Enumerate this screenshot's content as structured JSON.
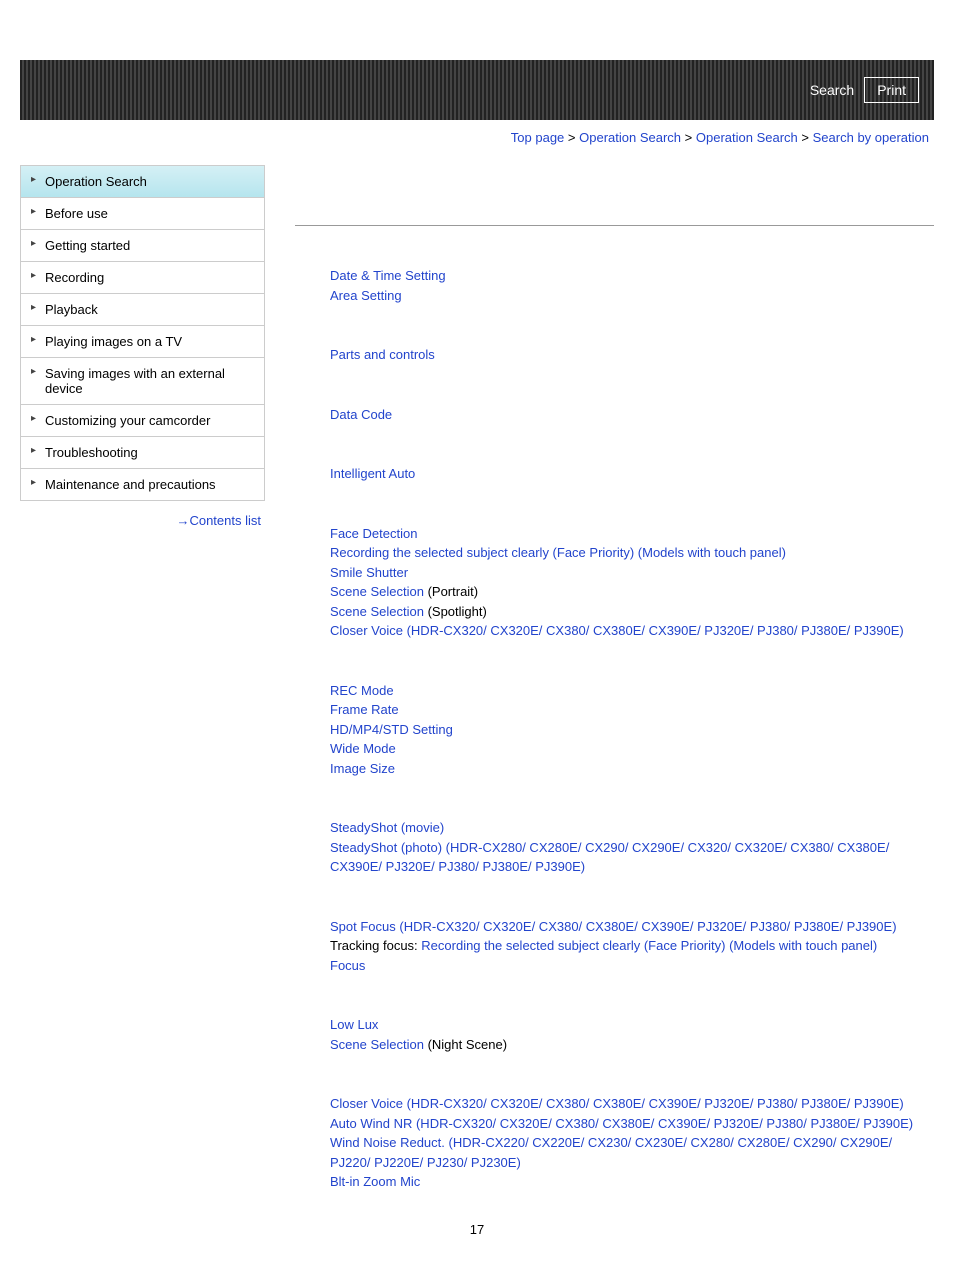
{
  "header": {
    "search": "Search",
    "print": "Print"
  },
  "breadcrumb": {
    "items": [
      "Top page",
      "Operation Search",
      "Operation Search",
      "Search by operation"
    ],
    "sep": ">"
  },
  "sidebar": {
    "items": [
      "Operation Search",
      "Before use",
      "Getting started",
      "Recording",
      "Playback",
      "Playing images on a TV",
      "Saving images with an external device",
      "Customizing your camcorder",
      "Troubleshooting",
      "Maintenance and precautions"
    ],
    "contents_arrow": "→",
    "contents_list": "Contents list"
  },
  "sections": {
    "s1": {
      "l1": "Date & Time Setting",
      "l2": "Area Setting"
    },
    "s2": {
      "l1": "Parts and controls"
    },
    "s3": {
      "l1": "Data Code"
    },
    "s4": {
      "l1": "Intelligent Auto"
    },
    "s5": {
      "l1": "Face Detection",
      "l2": "Recording the selected subject clearly (Face Priority) (Models with touch panel)",
      "l3": "Smile Shutter",
      "l4a": "Scene Selection",
      "l4b": " (Portrait)",
      "l5a": "Scene Selection",
      "l5b": " (Spotlight)",
      "l6": "Closer Voice (HDR-CX320/ CX320E/ CX380/ CX380E/ CX390E/ PJ320E/ PJ380/ PJ380E/ PJ390E)"
    },
    "s6": {
      "l1": "REC Mode",
      "l2": "Frame Rate",
      "l3": "HD/MP4/STD Setting",
      "l4": "Wide Mode",
      "l5": "Image Size"
    },
    "s7": {
      "l1": "SteadyShot (movie)",
      "l2": "SteadyShot (photo) (HDR-CX280/ CX280E/ CX290/ CX290E/ CX320/ CX320E/ CX380/ CX380E/ CX390E/ PJ320E/ PJ380/ PJ380E/ PJ390E)"
    },
    "s8": {
      "l1": "Spot Focus (HDR-CX320/ CX320E/ CX380/ CX380E/ CX390E/ PJ320E/ PJ380/ PJ380E/ PJ390E)",
      "l2a": "Tracking focus: ",
      "l2b": "Recording the selected subject clearly (Face Priority) (Models with touch panel)",
      "l3": "Focus"
    },
    "s9": {
      "l1": "Low Lux",
      "l2a": "Scene Selection",
      "l2b": " (Night Scene)"
    },
    "s10": {
      "l1": "Closer Voice (HDR-CX320/ CX320E/ CX380/ CX380E/ CX390E/ PJ320E/ PJ380/ PJ380E/ PJ390E)",
      "l2": "Auto Wind NR (HDR-CX320/ CX320E/ CX380/ CX380E/ CX390E/ PJ320E/ PJ380/ PJ380E/ PJ390E)",
      "l3": "Wind Noise Reduct. (HDR-CX220/ CX220E/ CX230/ CX230E/ CX280/ CX280E/ CX290/ CX290E/ PJ220/ PJ220E/ PJ230/ PJ230E)",
      "l4": "Blt-in Zoom Mic"
    }
  },
  "page_num": "17"
}
